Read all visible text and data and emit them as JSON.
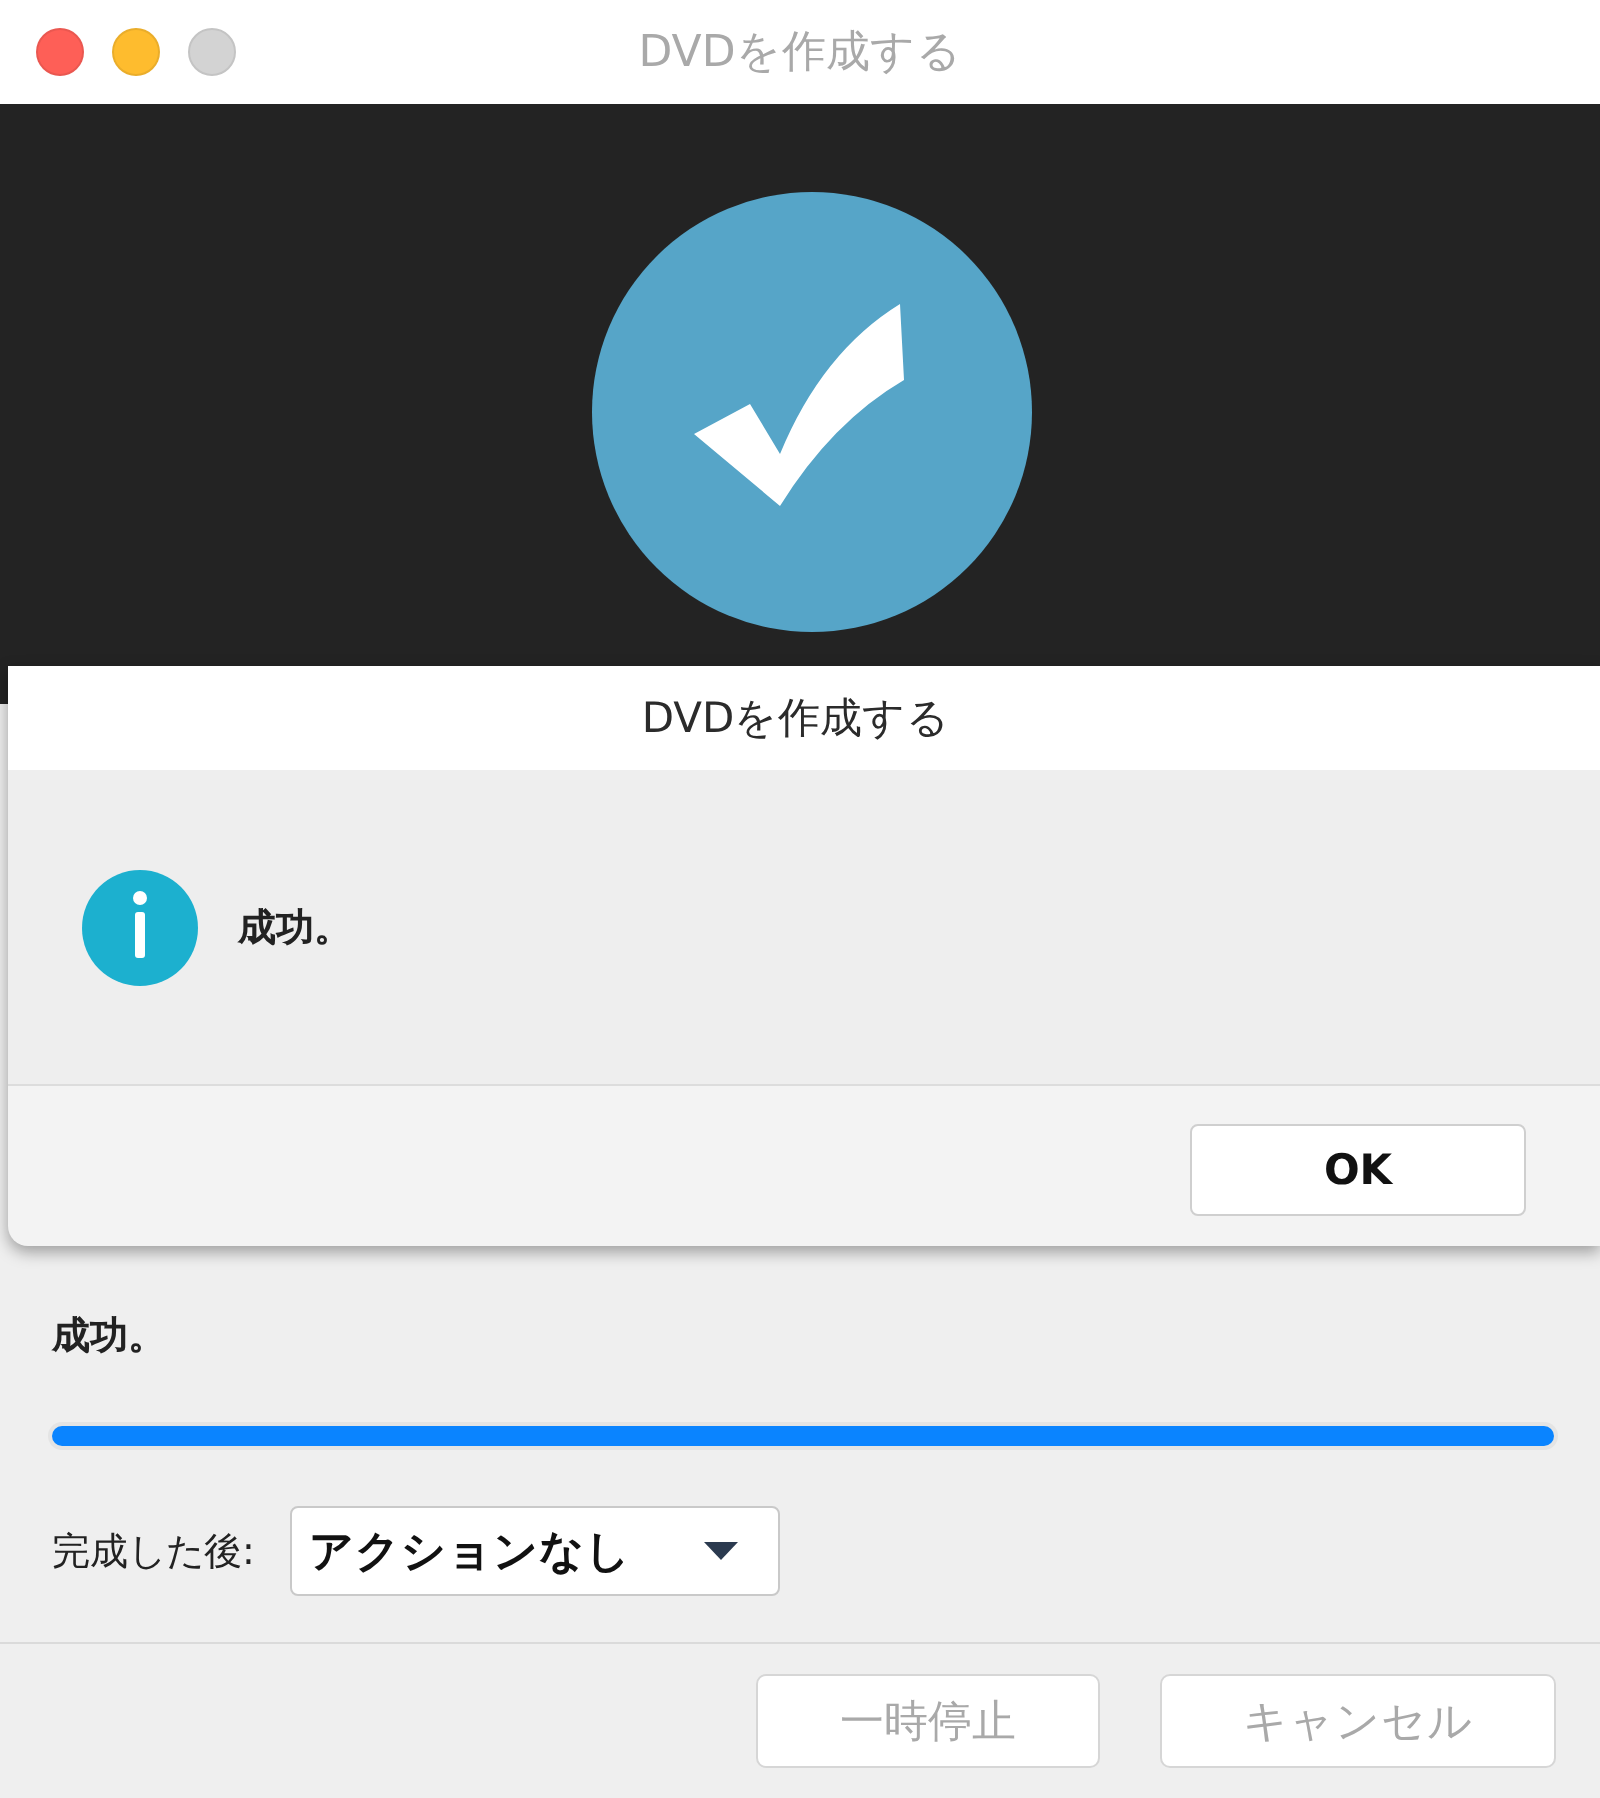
{
  "window": {
    "title": "DVDを作成する",
    "controls": [
      {
        "kind": "close",
        "disabled": false
      },
      {
        "kind": "minimize",
        "disabled": false
      },
      {
        "kind": "zoom",
        "disabled": true
      }
    ]
  },
  "status_text": "成功。",
  "progress": {
    "level": 1
  },
  "after_completion": {
    "label": "完成した後:",
    "value": "アクションなし"
  },
  "buttons": [
    {
      "label": "一時停止",
      "disabled": true
    },
    {
      "label": "キャンセル",
      "disabled": true
    }
  ],
  "dialog": {
    "title": "DVDを作成する",
    "message": "成功。",
    "buttons": [
      {
        "label": "OK",
        "disabled": false
      }
    ]
  }
}
